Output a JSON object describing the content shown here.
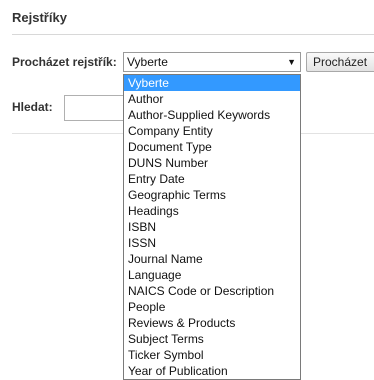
{
  "page": {
    "title": "Rejstříky"
  },
  "browse": {
    "label": "Procházet rejstřík:",
    "selected_value": "Vyberte",
    "button_label": "Procházet",
    "options": [
      "Vyberte",
      "Author",
      "Author-Supplied Keywords",
      "Company Entity",
      "Document Type",
      "DUNS Number",
      "Entry Date",
      "Geographic Terms",
      "Headings",
      "ISBN",
      "ISSN",
      "Journal Name",
      "Language",
      "NAICS Code or Description",
      "People",
      "Reviews & Products",
      "Subject Terms",
      "Ticker Symbol",
      "Year of Publication"
    ],
    "highlighted_option": "Vyberte",
    "arrow_icon": "triangle-down-icon"
  },
  "search": {
    "label": "Hledat:",
    "value": ""
  },
  "colors": {
    "highlight": "#3399ff"
  }
}
